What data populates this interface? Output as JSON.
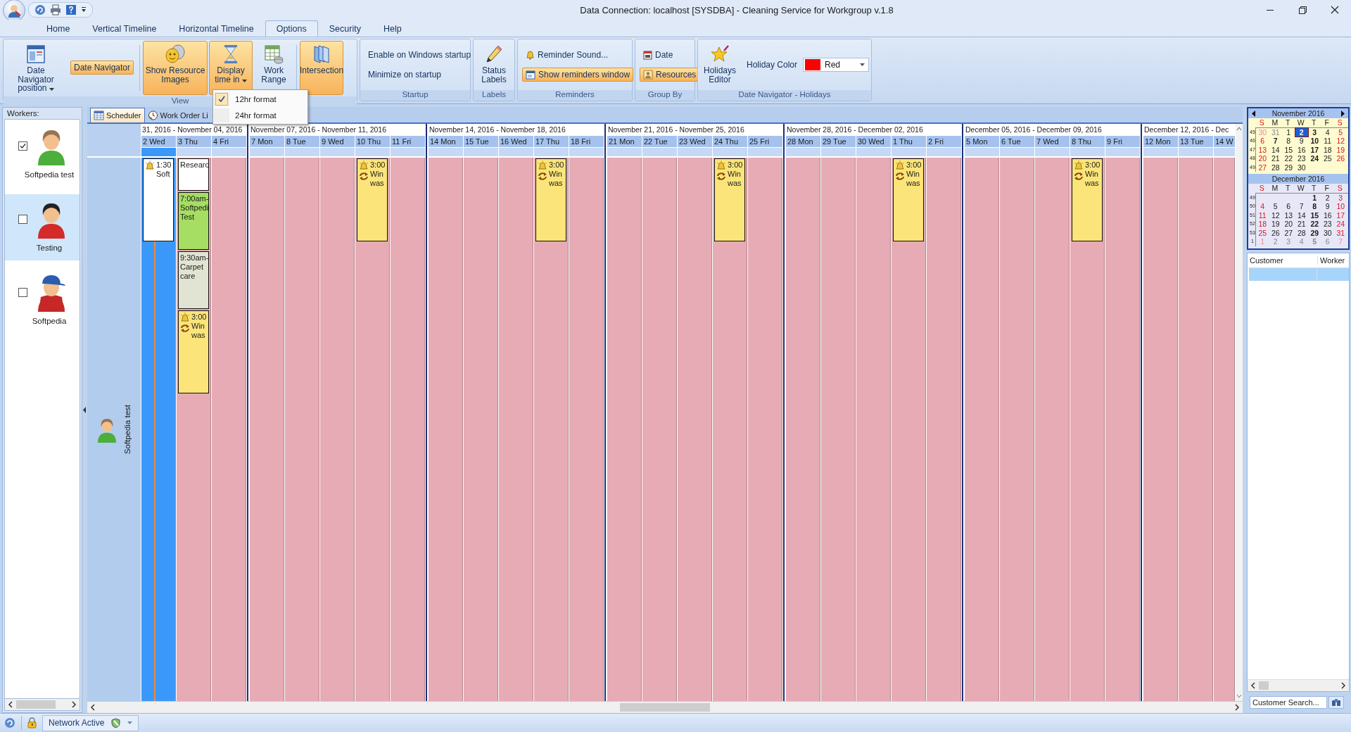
{
  "window": {
    "title": "Data Connection: localhost [SYSDBA] - Cleaning Service for Workgroup v.1.8"
  },
  "ribbon_tabs": [
    {
      "label": "Home",
      "selected": false
    },
    {
      "label": "Vertical Timeline",
      "selected": false
    },
    {
      "label": "Horizontal Timeline",
      "selected": false
    },
    {
      "label": "Options",
      "selected": true
    },
    {
      "label": "Security",
      "selected": false
    },
    {
      "label": "Help",
      "selected": false
    }
  ],
  "ribbon": {
    "view": {
      "label": "View",
      "date_navigator_position": "Date Navigator position",
      "date_navigator": {
        "label": "Date Navigator",
        "on": true
      },
      "show_resource_images": {
        "label": "Show Resource Images",
        "on": true
      },
      "display_time_in": {
        "label": "Display time in",
        "on": true
      },
      "work_range": {
        "label": "Work Range",
        "on": false
      },
      "intersection": {
        "label": "Intersection",
        "on": true
      }
    },
    "startup": {
      "label": "Startup",
      "items": [
        "Enable on Windows startup",
        "Minimize on startup"
      ]
    },
    "labels": {
      "label": "Labels",
      "status_labels": "Status Labels"
    },
    "reminders": {
      "label": "Reminders",
      "reminder_sound": {
        "label": "Reminder Sound...",
        "on": false
      },
      "show_reminders_window": {
        "label": "Show reminders window",
        "on": true
      }
    },
    "group_by": {
      "label": "Group By",
      "items": [
        {
          "label": "Date",
          "selected": false
        },
        {
          "label": "Resources",
          "selected": true
        }
      ]
    },
    "holidays": {
      "label": "Date Navigator - Holidays",
      "holidays_editor": "Holidays Editor",
      "holiday_color_label": "Holiday Color",
      "holiday_color": {
        "value": "Red",
        "color": "#ff0000"
      }
    }
  },
  "time_format_menu": [
    {
      "label": "12hr format",
      "checked": true
    },
    {
      "label": "24hr format",
      "checked": false
    }
  ],
  "workers_panel": {
    "title": "Workers:",
    "workers": [
      {
        "name": "Softpedia test",
        "checked": true,
        "selected": false
      },
      {
        "name": "Testing",
        "checked": false,
        "selected": true
      },
      {
        "name": "Softpedia",
        "checked": false,
        "selected": false
      }
    ]
  },
  "document_tabs": [
    {
      "label": "Scheduler",
      "selected": true
    },
    {
      "label": "Work Order Li",
      "selected": false
    }
  ],
  "timeline": {
    "resource": "Softpedia test",
    "weeks": [
      {
        "title": "31, 2016 - November 04, 2016",
        "days": [
          {
            "label": "2 Wed",
            "today": true,
            "events": [
              {
                "lines": [
                  "1:30",
                  "Soft"
                ],
                "color": "#ffffff",
                "alarm": true,
                "recurring": false
              }
            ]
          },
          {
            "label": "3 Thu",
            "today": false,
            "events": [
              {
                "lines": [
                  "Researc"
                ],
                "color": "#ffffff",
                "alarm": false,
                "recurring": false
              },
              {
                "lines": [
                  "7:00am-",
                  "Softpedi",
                  "Test"
                ],
                "color": "#a6dd63",
                "alarm": false,
                "recurring": false
              },
              {
                "lines": [
                  "9:30am-",
                  "Carpet",
                  "care"
                ],
                "color": "#e1e4d3",
                "alarm": false,
                "recurring": false
              },
              {
                "lines": [
                  "3:00",
                  "Win",
                  "was"
                ],
                "color": "#fbe57a",
                "alarm": true,
                "recurring": true
              }
            ]
          },
          {
            "label": "4 Fri",
            "today": false
          }
        ]
      },
      {
        "title": "November 07, 2016 - November 11, 2016",
        "days": [
          {
            "label": "7 Mon",
            "today": false
          },
          {
            "label": "8 Tue",
            "today": false
          },
          {
            "label": "9 Wed",
            "today": false
          },
          {
            "label": "10 Thu",
            "today": false,
            "events": [
              {
                "lines": [
                  "3:00",
                  "Win",
                  "was"
                ],
                "color": "#fbe57a",
                "alarm": true,
                "recurring": true
              }
            ]
          },
          {
            "label": "11 Fri",
            "today": false
          }
        ]
      },
      {
        "title": "November 14, 2016 - November 18, 2016",
        "days": [
          {
            "label": "14 Mon",
            "today": false
          },
          {
            "label": "15 Tue",
            "today": false
          },
          {
            "label": "16 Wed",
            "today": false
          },
          {
            "label": "17 Thu",
            "today": false,
            "events": [
              {
                "lines": [
                  "3:00",
                  "Win",
                  "was"
                ],
                "color": "#fbe57a",
                "alarm": true,
                "recurring": true
              }
            ]
          },
          {
            "label": "18 Fri",
            "today": false
          }
        ]
      },
      {
        "title": "November 21, 2016 - November 25, 2016",
        "days": [
          {
            "label": "21 Mon",
            "today": false
          },
          {
            "label": "22 Tue",
            "today": false
          },
          {
            "label": "23 Wed",
            "today": false
          },
          {
            "label": "24 Thu",
            "today": false,
            "events": [
              {
                "lines": [
                  "3:00",
                  "Win",
                  "was"
                ],
                "color": "#fbe57a",
                "alarm": true,
                "recurring": true
              }
            ]
          },
          {
            "label": "25 Fri",
            "today": false
          }
        ]
      },
      {
        "title": "November 28, 2016 - December 02, 2016",
        "days": [
          {
            "label": "28 Mon",
            "today": false
          },
          {
            "label": "29 Tue",
            "today": false
          },
          {
            "label": "30 Wed",
            "today": false
          },
          {
            "label": "1 Thu",
            "today": false,
            "events": [
              {
                "lines": [
                  "3:00",
                  "Win",
                  "was"
                ],
                "color": "#fbe57a",
                "alarm": true,
                "recurring": true
              }
            ]
          },
          {
            "label": "2 Fri",
            "today": false
          }
        ]
      },
      {
        "title": "December 05, 2016 - December 09, 2016",
        "days": [
          {
            "label": "5 Mon",
            "today": false
          },
          {
            "label": "6 Tue",
            "today": false
          },
          {
            "label": "7 Wed",
            "today": false
          },
          {
            "label": "8 Thu",
            "today": false,
            "events": [
              {
                "lines": [
                  "3:00",
                  "Win",
                  "was"
                ],
                "color": "#fbe57a",
                "alarm": true,
                "recurring": true
              }
            ]
          },
          {
            "label": "9 Fri",
            "today": false
          }
        ]
      },
      {
        "title": "December 12, 2016 - Dec",
        "days": [
          {
            "label": "12 Mon",
            "today": false
          },
          {
            "label": "13 Tue",
            "today": false
          },
          {
            "label": "14 W",
            "today": false
          }
        ]
      }
    ]
  },
  "date_navigator": {
    "months": [
      {
        "title": "November 2016",
        "weekday_names": [
          "S",
          "M",
          "T",
          "W",
          "T",
          "F",
          "S"
        ],
        "weeks": [
          {
            "number": "45",
            "days": [
              {
                "d": "30",
                "other": true,
                "bold": false,
                "selected": false
              },
              {
                "d": "31",
                "other": true,
                "bold": false,
                "selected": false
              },
              {
                "d": "1",
                "other": false,
                "bold": false,
                "selected": false
              },
              {
                "d": "2",
                "other": false,
                "bold": true,
                "selected": true
              },
              {
                "d": "3",
                "other": false,
                "bold": true,
                "selected": false
              },
              {
                "d": "4",
                "other": false,
                "bold": false,
                "selected": false
              },
              {
                "d": "5",
                "other": false,
                "bold": false,
                "selected": false
              }
            ]
          },
          {
            "number": "46",
            "days": [
              {
                "d": "6",
                "other": false,
                "bold": false,
                "selected": false
              },
              {
                "d": "7",
                "other": false,
                "bold": true,
                "selected": false
              },
              {
                "d": "8",
                "other": false,
                "bold": false,
                "selected": false
              },
              {
                "d": "9",
                "other": false,
                "bold": false,
                "selected": false
              },
              {
                "d": "10",
                "other": false,
                "bold": true,
                "selected": false
              },
              {
                "d": "11",
                "other": false,
                "bold": false,
                "selected": false
              },
              {
                "d": "12",
                "other": false,
                "bold": false,
                "selected": false
              }
            ]
          },
          {
            "number": "47",
            "days": [
              {
                "d": "13",
                "other": false,
                "bold": false,
                "selected": false
              },
              {
                "d": "14",
                "other": false,
                "bold": false,
                "selected": false
              },
              {
                "d": "15",
                "other": false,
                "bold": false,
                "selected": false
              },
              {
                "d": "16",
                "other": false,
                "bold": false,
                "selected": false
              },
              {
                "d": "17",
                "other": false,
                "bold": true,
                "selected": false
              },
              {
                "d": "18",
                "other": false,
                "bold": false,
                "selected": false
              },
              {
                "d": "19",
                "other": false,
                "bold": false,
                "selected": false
              }
            ]
          },
          {
            "number": "48",
            "days": [
              {
                "d": "20",
                "other": false,
                "bold": false,
                "selected": false
              },
              {
                "d": "21",
                "other": false,
                "bold": false,
                "selected": false
              },
              {
                "d": "22",
                "other": false,
                "bold": false,
                "selected": false
              },
              {
                "d": "23",
                "other": false,
                "bold": false,
                "selected": false
              },
              {
                "d": "24",
                "other": false,
                "bold": true,
                "selected": false
              },
              {
                "d": "25",
                "other": false,
                "bold": false,
                "selected": false
              },
              {
                "d": "26",
                "other": false,
                "bold": false,
                "selected": false
              }
            ]
          },
          {
            "number": "49",
            "days": [
              {
                "d": "27",
                "other": false,
                "bold": false,
                "selected": false
              },
              {
                "d": "28",
                "other": false,
                "bold": false,
                "selected": false
              },
              {
                "d": "29",
                "other": false,
                "bold": false,
                "selected": false
              },
              {
                "d": "30",
                "other": false,
                "bold": false,
                "selected": false
              }
            ]
          }
        ]
      },
      {
        "title": "December 2016",
        "weekday_names": [
          "S",
          "M",
          "T",
          "W",
          "T",
          "F",
          "S"
        ],
        "weeks": [
          {
            "number": "49",
            "days": [
              {
                "d": "1",
                "other": false,
                "bold": true,
                "selected": false
              },
              {
                "d": "2",
                "other": false,
                "bold": false,
                "selected": false
              },
              {
                "d": "3",
                "other": false,
                "bold": false,
                "selected": false
              }
            ]
          },
          {
            "number": "50",
            "days": [
              {
                "d": "4",
                "other": false,
                "bold": false,
                "selected": false
              },
              {
                "d": "5",
                "other": false,
                "bold": false,
                "selected": false
              },
              {
                "d": "6",
                "other": false,
                "bold": false,
                "selected": false
              },
              {
                "d": "7",
                "other": false,
                "bold": false,
                "selected": false
              },
              {
                "d": "8",
                "other": false,
                "bold": true,
                "selected": false
              },
              {
                "d": "9",
                "other": false,
                "bold": false,
                "selected": false
              },
              {
                "d": "10",
                "other": false,
                "bold": false,
                "selected": false
              }
            ]
          },
          {
            "number": "51",
            "days": [
              {
                "d": "11",
                "other": false,
                "bold": false,
                "selected": false
              },
              {
                "d": "12",
                "other": false,
                "bold": false,
                "selected": false
              },
              {
                "d": "13",
                "other": false,
                "bold": false,
                "selected": false
              },
              {
                "d": "14",
                "other": false,
                "bold": false,
                "selected": false
              },
              {
                "d": "15",
                "other": false,
                "bold": true,
                "selected": false
              },
              {
                "d": "16",
                "other": false,
                "bold": false,
                "selected": false
              },
              {
                "d": "17",
                "other": false,
                "bold": false,
                "selected": false
              }
            ]
          },
          {
            "number": "52",
            "days": [
              {
                "d": "18",
                "other": false,
                "bold": false,
                "selected": false
              },
              {
                "d": "19",
                "other": false,
                "bold": false,
                "selected": false
              },
              {
                "d": "20",
                "other": false,
                "bold": false,
                "selected": false
              },
              {
                "d": "21",
                "other": false,
                "bold": false,
                "selected": false
              },
              {
                "d": "22",
                "other": false,
                "bold": true,
                "selected": false
              },
              {
                "d": "23",
                "other": false,
                "bold": false,
                "selected": false
              },
              {
                "d": "24",
                "other": false,
                "bold": false,
                "selected": false
              }
            ]
          },
          {
            "number": "53",
            "days": [
              {
                "d": "25",
                "other": false,
                "bold": false,
                "selected": false
              },
              {
                "d": "26",
                "other": false,
                "bold": false,
                "selected": false
              },
              {
                "d": "27",
                "other": false,
                "bold": false,
                "selected": false
              },
              {
                "d": "28",
                "other": false,
                "bold": false,
                "selected": false
              },
              {
                "d": "29",
                "other": false,
                "bold": true,
                "selected": false
              },
              {
                "d": "30",
                "other": false,
                "bold": false,
                "selected": false
              },
              {
                "d": "31",
                "other": false,
                "bold": false,
                "selected": false
              }
            ]
          },
          {
            "number": "1",
            "days": [
              {
                "d": "1",
                "other": true,
                "bold": false,
                "selected": false
              },
              {
                "d": "2",
                "other": true,
                "bold": false,
                "selected": false
              },
              {
                "d": "3",
                "other": true,
                "bold": false,
                "selected": false
              },
              {
                "d": "4",
                "other": true,
                "bold": false,
                "selected": false
              },
              {
                "d": "5",
                "other": true,
                "bold": true,
                "selected": false
              },
              {
                "d": "6",
                "other": true,
                "bold": false,
                "selected": false
              },
              {
                "d": "7",
                "other": true,
                "bold": false,
                "selected": false
              }
            ]
          }
        ]
      }
    ]
  },
  "customer_grid": {
    "columns": [
      "Customer",
      "Worker"
    ]
  },
  "customer_search": {
    "placeholder": "Customer Search..."
  },
  "status_bar": {
    "network": "Network Active"
  }
}
